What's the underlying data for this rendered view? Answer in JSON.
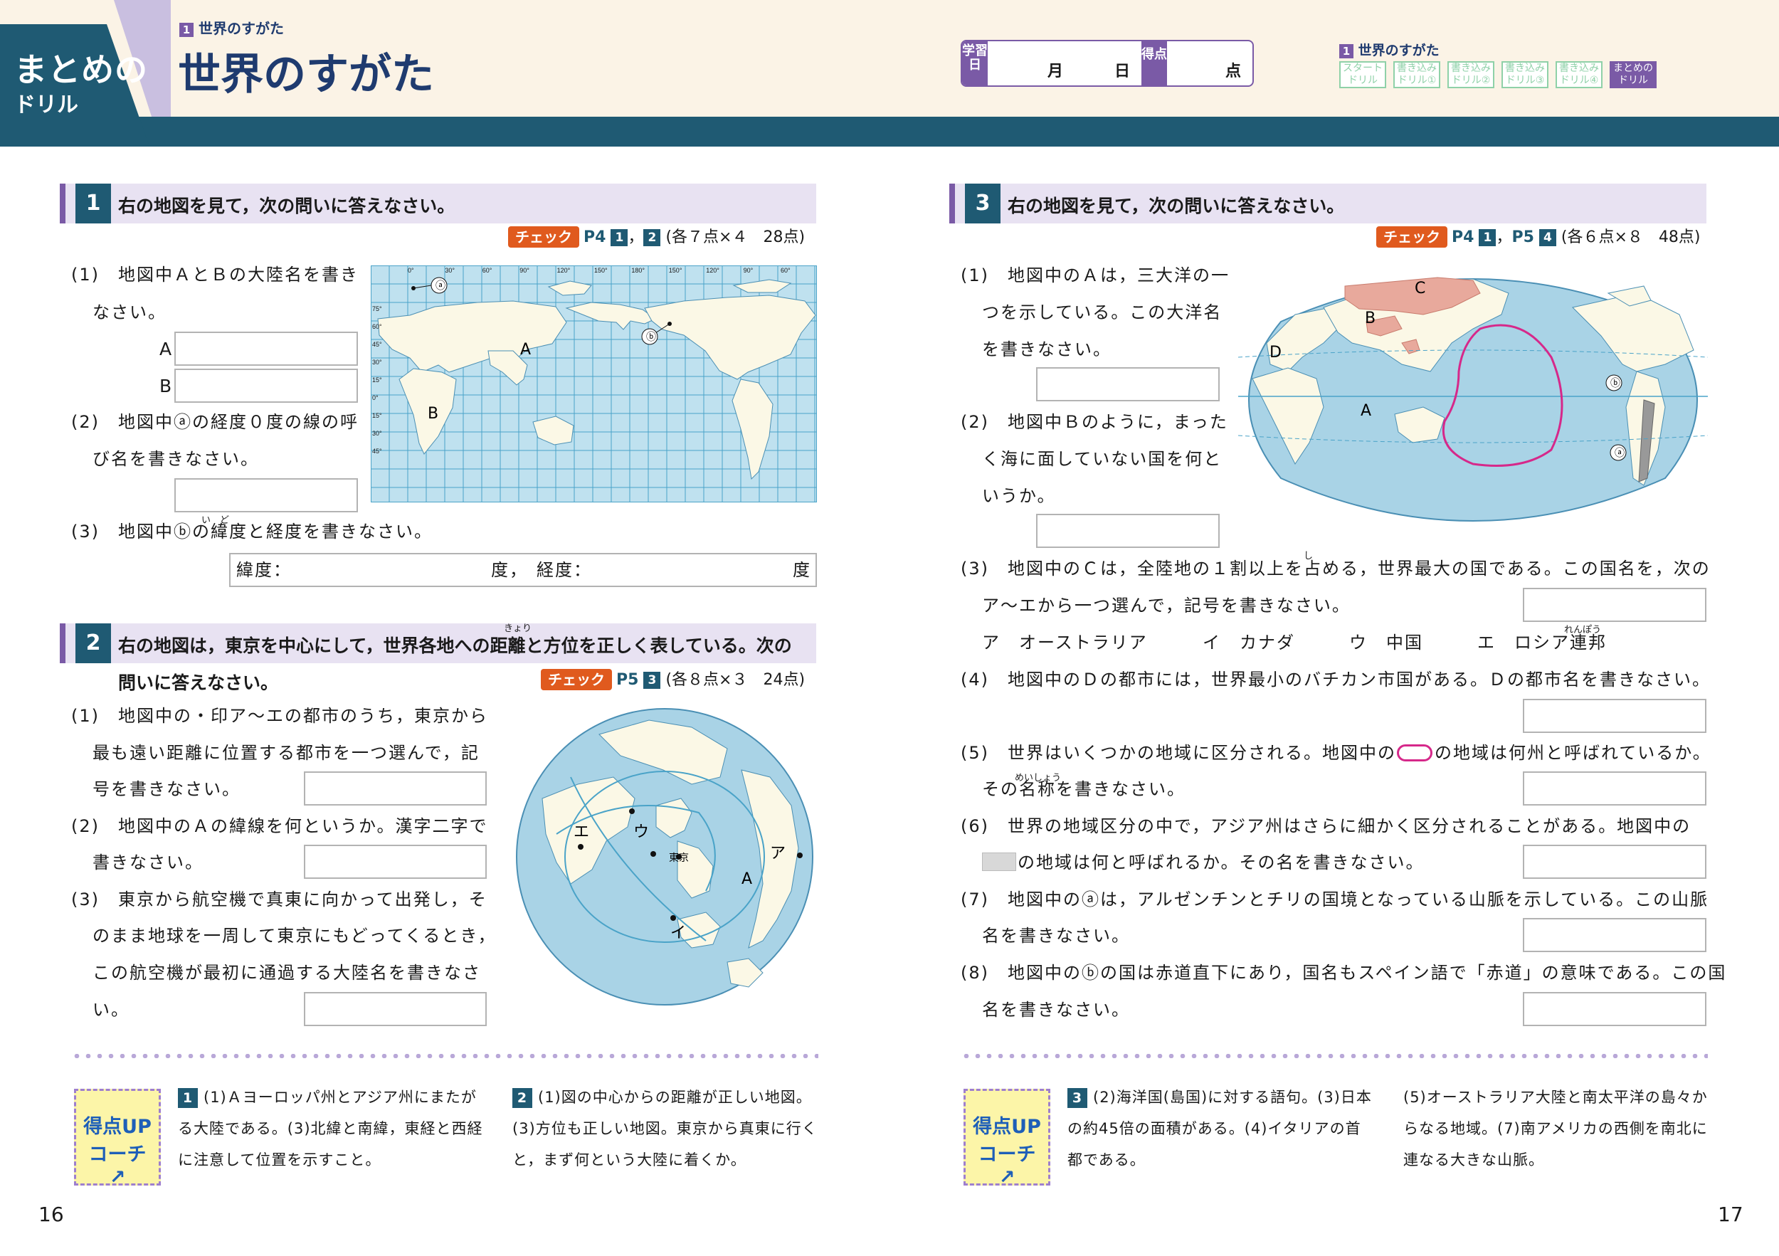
{
  "header": {
    "tag_line1": "まとめの",
    "tag_line2": "ドリル",
    "unit_number": "1",
    "unit_label": "世界のすがた",
    "title": "世界のすがた",
    "date_label": "学習日",
    "month": "月",
    "day": "日",
    "score_label": "得点",
    "score_unit": "点",
    "nav_title": "世界のすがた",
    "nav": [
      {
        "l1": "スタート",
        "l2": "ドリル",
        "active": false
      },
      {
        "l1": "書き込み",
        "l2": "ドリル①",
        "active": false
      },
      {
        "l1": "書き込み",
        "l2": "ドリル②",
        "active": false
      },
      {
        "l1": "書き込み",
        "l2": "ドリル③",
        "active": false
      },
      {
        "l1": "書き込み",
        "l2": "ドリル④",
        "active": false
      },
      {
        "l1": "まとめの",
        "l2": "ドリル",
        "active": true
      }
    ]
  },
  "q1": {
    "num": "1",
    "text": "右の地図を見て，次の問いに答えなさい。",
    "check": {
      "badge": "チェック",
      "p1": "P4",
      "s1": "1",
      "sep": "，",
      "s2": "2",
      "points": "(各７点×４　28点)"
    },
    "p1_l1": "(1)　地図中ＡとＢの大陸名を書き",
    "p1_l2": "なさい。",
    "a": "A",
    "b": "B",
    "p2_l1": "(2)　地図中ⓐの経度０度の線の呼",
    "p2_l2": "び名を書きなさい。",
    "p3": "(3)　地図中ⓑの緯度と経度を書きなさい。",
    "p3_ruby": "い　ど",
    "lat_label": "緯度：",
    "deg1": "度，",
    "lon_label": "経度：",
    "deg2": "度",
    "map_labels": {
      "a": "ⓐ",
      "b": "ⓑ",
      "A": "A",
      "B": "B"
    },
    "lon_ticks": [
      "0°",
      "30°",
      "60°",
      "90°",
      "120°",
      "150°",
      "180°",
      "150°",
      "120°",
      "90°",
      "60°"
    ],
    "lat_ticks": [
      "75°",
      "60°",
      "45°",
      "30°",
      "15°",
      "0°",
      "15°",
      "30°",
      "45°"
    ]
  },
  "q2": {
    "num": "2",
    "text_l1": "右の地図は，東京を中心にして，世界各地への距離と方位を正しく表している。次の",
    "text_l2": "問いに答えなさい。",
    "ruby": "きょり",
    "check": {
      "badge": "チェック",
      "p1": "P5",
      "s1": "3",
      "points": "(各８点×３　24点)"
    },
    "p1_l1": "(1)　地図中の・印ア～エの都市のうち，東京から",
    "p1_l2": "最も遠い距離に位置する都市を一つ選んで，記",
    "p1_l3": "号を書きなさい。",
    "p2_l1": "(2)　地図中のＡの緯線を何というか。漢字二字で",
    "p2_l2": "書きなさい。",
    "p3_l1": "(3)　東京から航空機で真東に向かって出発し，そ",
    "p3_l2": "のまま地球を一周して東京にもどってくるとき，",
    "p3_l3": "この航空機が最初に通過する大陸名を書きなさ",
    "p3_l4": "い。",
    "map_labels": {
      "e": "エ",
      "u": "ウ",
      "tokyo": "東京",
      "a": "ア",
      "A": "A",
      "i": "イ"
    }
  },
  "q3": {
    "num": "3",
    "text": "右の地図を見て，次の問いに答えなさい。",
    "check": {
      "badge": "チェック",
      "p1": "P4",
      "s1": "1",
      "sep": "，",
      "p2": "P5",
      "s2": "4",
      "points": "(各６点×８　48点)"
    },
    "p1_l1": "(1)　地図中のＡは，三大洋の一",
    "p1_l2": "つを示している。この大洋名",
    "p1_l3": "を書きなさい。",
    "p2_l1": "(2)　地図中Ｂのように，まった",
    "p2_l2": "く海に面していない国を何と",
    "p2_l3": "いうか。",
    "p3_l1": "(3)　地図中のＣは，全陸地の１割以上を占める，世界最大の国である。この国名を，次の",
    "p3_ruby": "し",
    "p3_l2": "ア～エから一つ選んで，記号を書きなさい。",
    "c_a": "ア　オーストラリア",
    "c_i": "イ　カナダ",
    "c_u": "ウ　中国",
    "c_e": "エ　ロシア連邦",
    "c_ruby": "れんぽう",
    "p4": "(4)　地図中のＤの都市には，世界最小のバチカン市国がある。Ｄの都市名を書きなさい。",
    "p5_l1a": "(5)　世界はいくつかの地域に区分される。地図中の",
    "p5_l1b": "の地域は何州と呼ばれているか。",
    "p5_l2": "その名称を書きなさい。",
    "p5_ruby": "めいしょう",
    "p6_l1": "(6)　世界の地域区分の中で，アジア州はさらに細かく区分されることがある。地図中の",
    "p6_l2": "の地域は何と呼ばれるか。その名を書きなさい。",
    "p7_l1": "(7)　地図中のⓐは，アルゼンチンとチリの国境となっている山脈を示している。この山脈",
    "p7_l2": "名を書きなさい。",
    "p8_l1": "(8)　地図中のⓑの国は赤道直下にあり，国名もスペイン語で「赤道」の意味である。この国",
    "p8_l2": "名を書きなさい。",
    "map_labels": {
      "C": "C",
      "B": "B",
      "D": "D",
      "A": "A",
      "b": "ⓑ",
      "a": "ⓐ"
    }
  },
  "coach": {
    "label1": "得点UP",
    "label2": "コーチ",
    "left": {
      "n1": "1",
      "h1_l1": "(1)Ａヨーロッパ州とアジア州にまたが",
      "h1_l2": "る大陸である。(3)北緯と南緯，東経と西経",
      "h1_l3": "に注意して位置を示すこと。",
      "n2": "2",
      "h2_l1": "(1)図の中心からの距離が正しい地図。",
      "h2_l2": "(3)方位も正しい地図。東京から真東に行く",
      "h2_l3": "と，まず何という大陸に着くか。"
    },
    "right": {
      "n3": "3",
      "h3_l1": "(2)海洋国(島国)に対する語句。(3)日本",
      "h3_l2": "の約45倍の面積がある。(4)イタリアの首",
      "h3_l3": "都である。",
      "h3_r1": "(5)オーストラリア大陸と南太平洋の島々か",
      "h3_r2": "らなる地域。(7)南アメリカの西側を南北に",
      "h3_r3": "連なる大きな山脈。"
    }
  },
  "page_left": "16",
  "page_right": "17",
  "colors": {
    "teal": "#1f5a73",
    "purple": "#7a5aa6",
    "orange": "#e05a1e",
    "ocean": "#a9d3e6",
    "land": "#fbf8e6"
  }
}
